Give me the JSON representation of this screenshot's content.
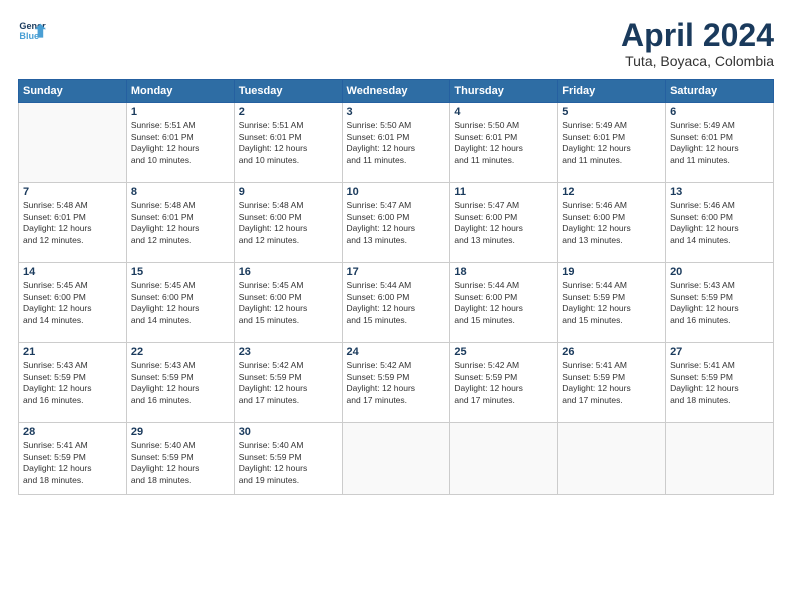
{
  "logo": {
    "line1": "General",
    "line2": "Blue"
  },
  "title": "April 2024",
  "subtitle": "Tuta, Boyaca, Colombia",
  "headers": [
    "Sunday",
    "Monday",
    "Tuesday",
    "Wednesday",
    "Thursday",
    "Friday",
    "Saturday"
  ],
  "weeks": [
    [
      {
        "day": "",
        "content": ""
      },
      {
        "day": "1",
        "content": "Sunrise: 5:51 AM\nSunset: 6:01 PM\nDaylight: 12 hours\nand 10 minutes."
      },
      {
        "day": "2",
        "content": "Sunrise: 5:51 AM\nSunset: 6:01 PM\nDaylight: 12 hours\nand 10 minutes."
      },
      {
        "day": "3",
        "content": "Sunrise: 5:50 AM\nSunset: 6:01 PM\nDaylight: 12 hours\nand 11 minutes."
      },
      {
        "day": "4",
        "content": "Sunrise: 5:50 AM\nSunset: 6:01 PM\nDaylight: 12 hours\nand 11 minutes."
      },
      {
        "day": "5",
        "content": "Sunrise: 5:49 AM\nSunset: 6:01 PM\nDaylight: 12 hours\nand 11 minutes."
      },
      {
        "day": "6",
        "content": "Sunrise: 5:49 AM\nSunset: 6:01 PM\nDaylight: 12 hours\nand 11 minutes."
      }
    ],
    [
      {
        "day": "7",
        "content": "Sunrise: 5:48 AM\nSunset: 6:01 PM\nDaylight: 12 hours\nand 12 minutes."
      },
      {
        "day": "8",
        "content": "Sunrise: 5:48 AM\nSunset: 6:01 PM\nDaylight: 12 hours\nand 12 minutes."
      },
      {
        "day": "9",
        "content": "Sunrise: 5:48 AM\nSunset: 6:00 PM\nDaylight: 12 hours\nand 12 minutes."
      },
      {
        "day": "10",
        "content": "Sunrise: 5:47 AM\nSunset: 6:00 PM\nDaylight: 12 hours\nand 13 minutes."
      },
      {
        "day": "11",
        "content": "Sunrise: 5:47 AM\nSunset: 6:00 PM\nDaylight: 12 hours\nand 13 minutes."
      },
      {
        "day": "12",
        "content": "Sunrise: 5:46 AM\nSunset: 6:00 PM\nDaylight: 12 hours\nand 13 minutes."
      },
      {
        "day": "13",
        "content": "Sunrise: 5:46 AM\nSunset: 6:00 PM\nDaylight: 12 hours\nand 14 minutes."
      }
    ],
    [
      {
        "day": "14",
        "content": "Sunrise: 5:45 AM\nSunset: 6:00 PM\nDaylight: 12 hours\nand 14 minutes."
      },
      {
        "day": "15",
        "content": "Sunrise: 5:45 AM\nSunset: 6:00 PM\nDaylight: 12 hours\nand 14 minutes."
      },
      {
        "day": "16",
        "content": "Sunrise: 5:45 AM\nSunset: 6:00 PM\nDaylight: 12 hours\nand 15 minutes."
      },
      {
        "day": "17",
        "content": "Sunrise: 5:44 AM\nSunset: 6:00 PM\nDaylight: 12 hours\nand 15 minutes."
      },
      {
        "day": "18",
        "content": "Sunrise: 5:44 AM\nSunset: 6:00 PM\nDaylight: 12 hours\nand 15 minutes."
      },
      {
        "day": "19",
        "content": "Sunrise: 5:44 AM\nSunset: 5:59 PM\nDaylight: 12 hours\nand 15 minutes."
      },
      {
        "day": "20",
        "content": "Sunrise: 5:43 AM\nSunset: 5:59 PM\nDaylight: 12 hours\nand 16 minutes."
      }
    ],
    [
      {
        "day": "21",
        "content": "Sunrise: 5:43 AM\nSunset: 5:59 PM\nDaylight: 12 hours\nand 16 minutes."
      },
      {
        "day": "22",
        "content": "Sunrise: 5:43 AM\nSunset: 5:59 PM\nDaylight: 12 hours\nand 16 minutes."
      },
      {
        "day": "23",
        "content": "Sunrise: 5:42 AM\nSunset: 5:59 PM\nDaylight: 12 hours\nand 17 minutes."
      },
      {
        "day": "24",
        "content": "Sunrise: 5:42 AM\nSunset: 5:59 PM\nDaylight: 12 hours\nand 17 minutes."
      },
      {
        "day": "25",
        "content": "Sunrise: 5:42 AM\nSunset: 5:59 PM\nDaylight: 12 hours\nand 17 minutes."
      },
      {
        "day": "26",
        "content": "Sunrise: 5:41 AM\nSunset: 5:59 PM\nDaylight: 12 hours\nand 17 minutes."
      },
      {
        "day": "27",
        "content": "Sunrise: 5:41 AM\nSunset: 5:59 PM\nDaylight: 12 hours\nand 18 minutes."
      }
    ],
    [
      {
        "day": "28",
        "content": "Sunrise: 5:41 AM\nSunset: 5:59 PM\nDaylight: 12 hours\nand 18 minutes."
      },
      {
        "day": "29",
        "content": "Sunrise: 5:40 AM\nSunset: 5:59 PM\nDaylight: 12 hours\nand 18 minutes."
      },
      {
        "day": "30",
        "content": "Sunrise: 5:40 AM\nSunset: 5:59 PM\nDaylight: 12 hours\nand 19 minutes."
      },
      {
        "day": "",
        "content": ""
      },
      {
        "day": "",
        "content": ""
      },
      {
        "day": "",
        "content": ""
      },
      {
        "day": "",
        "content": ""
      }
    ]
  ]
}
